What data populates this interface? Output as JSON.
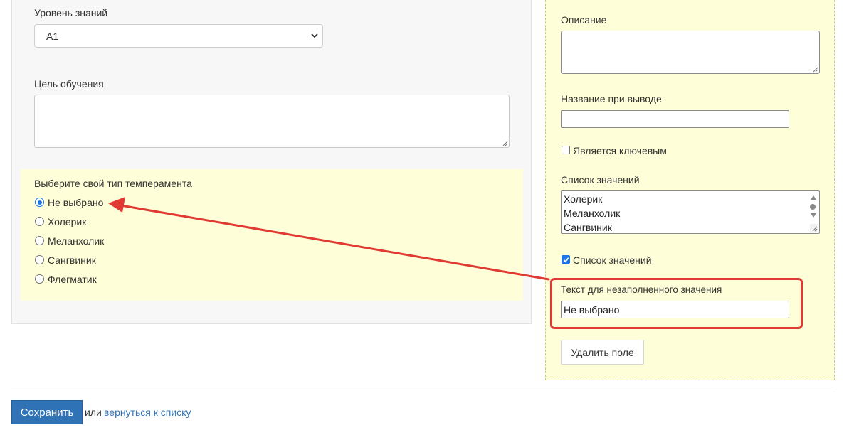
{
  "form": {
    "knowledge_level": {
      "label": "Уровень знаний",
      "value": "A1"
    },
    "learning_goal": {
      "label": "Цель обучения",
      "value": ""
    },
    "temperament": {
      "label": "Выберите свой тип темперамента",
      "options": [
        "Не выбрано",
        "Холерик",
        "Меланхолик",
        "Сангвиник",
        "Флегматик"
      ],
      "selected": "Не выбрано"
    }
  },
  "properties": {
    "description": {
      "label": "Описание",
      "value": ""
    },
    "display_name": {
      "label": "Название при выводе",
      "value": ""
    },
    "is_key": {
      "label": "Является ключевым",
      "checked": false
    },
    "value_list": {
      "label": "Список значений",
      "items": [
        "Холерик",
        "Меланхолик",
        "Сангвиник"
      ]
    },
    "value_list_toggle": {
      "label": "Список значений",
      "checked": true
    },
    "empty_value_text": {
      "label": "Текст для незаполненного значения",
      "value": "Не выбрано"
    },
    "delete_label": "Удалить поле"
  },
  "footer": {
    "save_label": "Сохранить",
    "or_text": "или",
    "back_link": "вернуться к списку"
  },
  "colors": {
    "accent": "#2f73b6",
    "highlight": "#e03a32",
    "panel_yellow": "#fefed9"
  },
  "icons": [
    "chevron-down-icon",
    "resize-grip-icon",
    "scroll-up-icon",
    "scroll-down-icon",
    "checkmark-icon",
    "annotation-arrow"
  ]
}
